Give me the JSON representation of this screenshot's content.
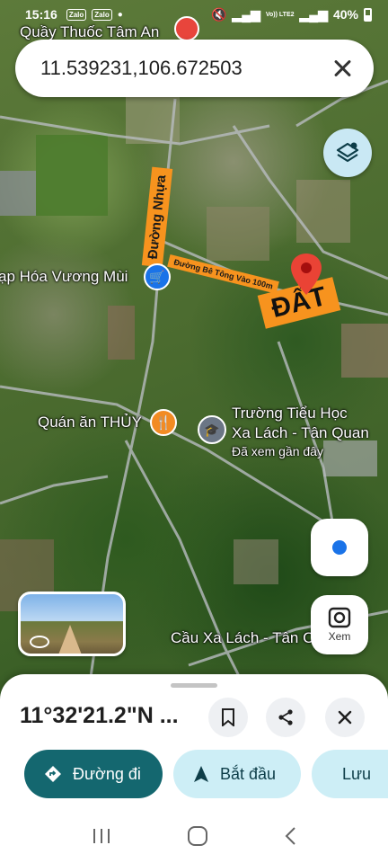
{
  "status_bar": {
    "time": "15:16",
    "apps": [
      "Zalo",
      "Zalo"
    ],
    "network": "Vo)) LTE2",
    "battery": "40%"
  },
  "search": {
    "query": "11.539231,106.672503",
    "close_icon": "close-icon"
  },
  "map": {
    "poi_top": "Quầy Thuốc Tâm An",
    "road_asphalt": "Đường Nhựa",
    "road_concrete": "Đường Bê Tông Vào 100m",
    "land_label": "ĐẤT",
    "store": "ạp Hóa Vương Mùi",
    "restaurant": "Quán ăn THỦY",
    "school_line1": "Trường Tiểu Học",
    "school_line2": "Xa Lách - Tân Quan",
    "school_note": "Đã xem gần đây",
    "bridge": "Cầu Xa Lách - Tân C",
    "pin_color": "#ea4335",
    "label_color": "#f7931e"
  },
  "controls": {
    "layers_icon": "layers-icon",
    "location_icon": "my-location-icon",
    "lens_icon": "lens-icon",
    "lens_label": "Xem"
  },
  "sheet": {
    "title": "11°32'21.2\"N ...",
    "buttons": {
      "directions": "Đường đi",
      "start": "Bắt đầu",
      "save": "Lưu"
    },
    "accent": "#14676f"
  }
}
